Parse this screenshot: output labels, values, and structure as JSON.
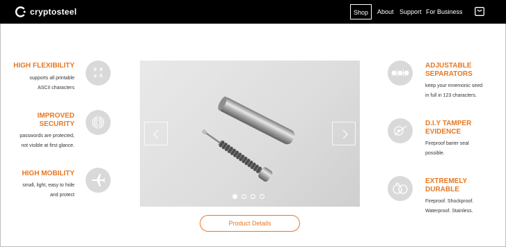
{
  "header": {
    "logo_text": "cryptosteel",
    "nav": [
      "Shop",
      "About",
      "Support",
      "For Business"
    ]
  },
  "features_left": [
    {
      "title": "HIGH FLEXIBILITY",
      "desc": [
        "supports all printable",
        "ASCII characters"
      ],
      "icon": "ascii-characters-icon"
    },
    {
      "title": [
        "IMPROVED",
        "SECURITY"
      ],
      "desc": [
        "passwords are protected,",
        "not visible at first glance."
      ],
      "icon": "fingerprint-icon"
    },
    {
      "title": "HIGH MOBILITY",
      "desc": [
        "small, light, easy to hide",
        "and protect"
      ],
      "icon": "airplane-icon"
    }
  ],
  "features_right": [
    {
      "title": [
        "ADJUSTABLE",
        "SEPARATORS"
      ],
      "desc": [
        "keep your mnemonic seed",
        "in full in 123 characters."
      ],
      "icon": "separators-icon"
    },
    {
      "title": [
        "D.I.Y TAMPER",
        "EVIDENCE"
      ],
      "desc": [
        "Fireproof barier seal",
        "possible."
      ],
      "icon": "tamper-seal-icon"
    },
    {
      "title": [
        "EXTREMELY",
        "DURABLE"
      ],
      "desc": [
        "Fireproof. Shockproof.",
        "Waterproof. Stainless."
      ],
      "icon": "durable-rings-icon"
    }
  ],
  "ascii_icon_text": {
    "row1": "0 #",
    "row2": "a A"
  },
  "carousel": {
    "slides": 4,
    "active": 0
  },
  "cta": {
    "label": "Product Details"
  },
  "colors": {
    "accent": "#e87722",
    "header": "#000000",
    "icon_bg": "#d9d9d9"
  }
}
